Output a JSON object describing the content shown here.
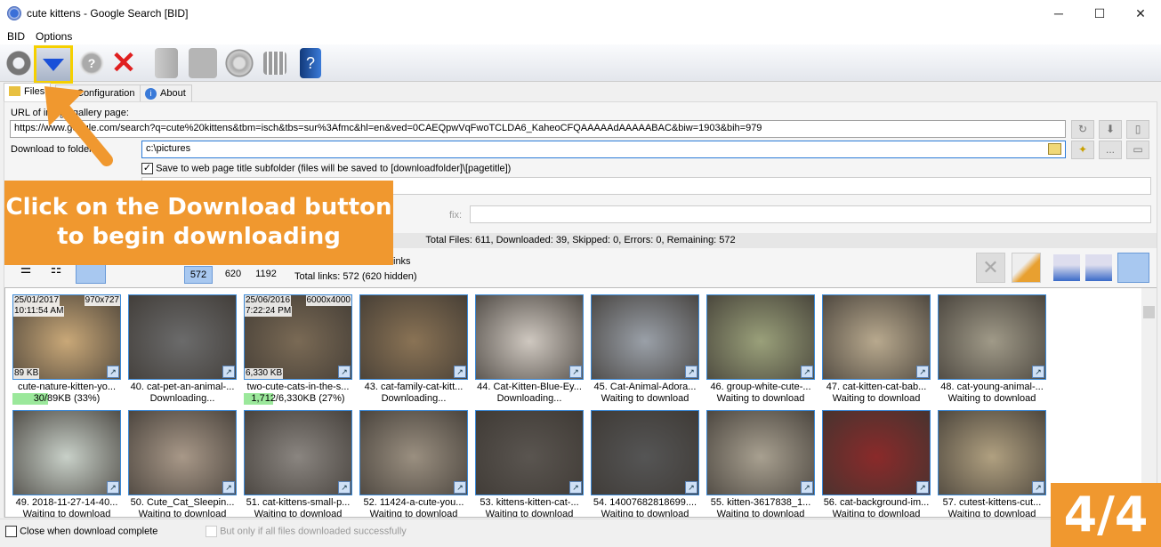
{
  "window": {
    "title": "cute kittens - Google Search [BID]",
    "minimize": "─",
    "maximize": "☐",
    "close": "✕"
  },
  "menu": [
    "BID",
    "Options"
  ],
  "toolbar": {
    "buttons": [
      {
        "name": "refresh-icon"
      },
      {
        "name": "download-icon",
        "highlighted": true
      },
      {
        "name": "help-icon"
      },
      {
        "name": "stop-icon"
      },
      {
        "name": "folder-icon"
      },
      {
        "name": "save-icon"
      },
      {
        "name": "settings-icon"
      },
      {
        "name": "grid-icon"
      },
      {
        "name": "help-book-icon"
      }
    ]
  },
  "tabs": [
    "Files",
    "Configuration",
    "About"
  ],
  "form": {
    "url_label": "URL of image gallery page:",
    "url_value": "https://www.google.com/search?q=cute%20kittens&tbm=isch&tbs=sur%3Afmc&hl=en&ved=0CAEQpwVqFwoTCLDA6_KaheoCFQAAAAAdAAAAABAC&biw=1903&bih=979",
    "folder_label": "Download to folder:",
    "folder_value": "c:\\pictures",
    "subfolder_label": "Save to web page title subfolder (files will be saved to [downloadfolder]\\[pagetitle])",
    "subfolder_checked": true,
    "prefix_label": "fix:",
    "browse_label": "..."
  },
  "status": "Total Files: 611, Downloaded: 39, Skipped: 0, Errors: 0, Remaining: 572",
  "filters": {
    "counts": [
      "572",
      "620",
      "1192"
    ],
    "links_label": "inks",
    "total_links": "Total links: 572 (620 hidden)"
  },
  "tiles": [
    {
      "caption": "cute-nature-kitten-yo...",
      "status": "30/89KB (33%)",
      "progress": 33,
      "date": "25/01/2017",
      "time": "10:11:54 AM",
      "dims": "970x727",
      "size": "89 KB",
      "color": "#c9a878"
    },
    {
      "caption": "40. cat-pet-an-animal-...",
      "status": "Downloading...",
      "color": "#6b6b6b"
    },
    {
      "caption": "two-cute-cats-in-the-s...",
      "status": "1,712/6,330KB (27%)",
      "progress": 27,
      "date": "25/06/2016",
      "time": "7:22:24 PM",
      "dims": "6000x4000",
      "size": "6,330 KB",
      "color": "#7a6a55"
    },
    {
      "caption": "43. cat-family-cat-kitt...",
      "status": "Downloading...",
      "color": "#8a7355"
    },
    {
      "caption": "44. Cat-Kitten-Blue-Ey...",
      "status": "Downloading...",
      "color": "#cfc8c0"
    },
    {
      "caption": "45. Cat-Animal-Adora...",
      "status": "Waiting to download",
      "color": "#9aa0a8"
    },
    {
      "caption": "46. group-white-cute-...",
      "status": "Waiting to download",
      "color": "#9aa07a"
    },
    {
      "caption": "47. cat-kitten-cat-bab...",
      "status": "Waiting to download",
      "color": "#b8a98e"
    },
    {
      "caption": "48. cat-young-animal-...",
      "status": "Waiting to download",
      "color": "#a09a88"
    },
    {
      "caption": "49. 2018-11-27-14-40...",
      "status": "Waiting to download",
      "color": "#c8d0c8"
    },
    {
      "caption": "50. Cute_Cat_Sleepin...",
      "status": "Waiting to download",
      "color": "#a89888"
    },
    {
      "caption": "51. cat-kittens-small-p...",
      "status": "Waiting to download",
      "color": "#8a8580"
    },
    {
      "caption": "52. 11424-a-cute-you...",
      "status": "Waiting to download",
      "color": "#9a8f80"
    },
    {
      "caption": "53. kittens-kitten-cat-...",
      "status": "Waiting to download",
      "color": "#5a5550"
    },
    {
      "caption": "54. 14007682818699....",
      "status": "Waiting to download",
      "color": "#555"
    },
    {
      "caption": "55. kitten-3617838_1...",
      "status": "Waiting to download",
      "color": "#a8a090"
    },
    {
      "caption": "56. cat-background-im...",
      "status": "Waiting to download",
      "color": "#8a2a2a"
    },
    {
      "caption": "57. cutest-kittens-cut...",
      "status": "Waiting to download",
      "color": "#b0a080"
    }
  ],
  "footer": {
    "close_label": "Close when download complete",
    "only_label": "But only if all files downloaded successfully"
  },
  "tutorial": {
    "callout": "Click on the Download button to begin downloading",
    "step": "4/4",
    "accent": "#f0982f"
  }
}
